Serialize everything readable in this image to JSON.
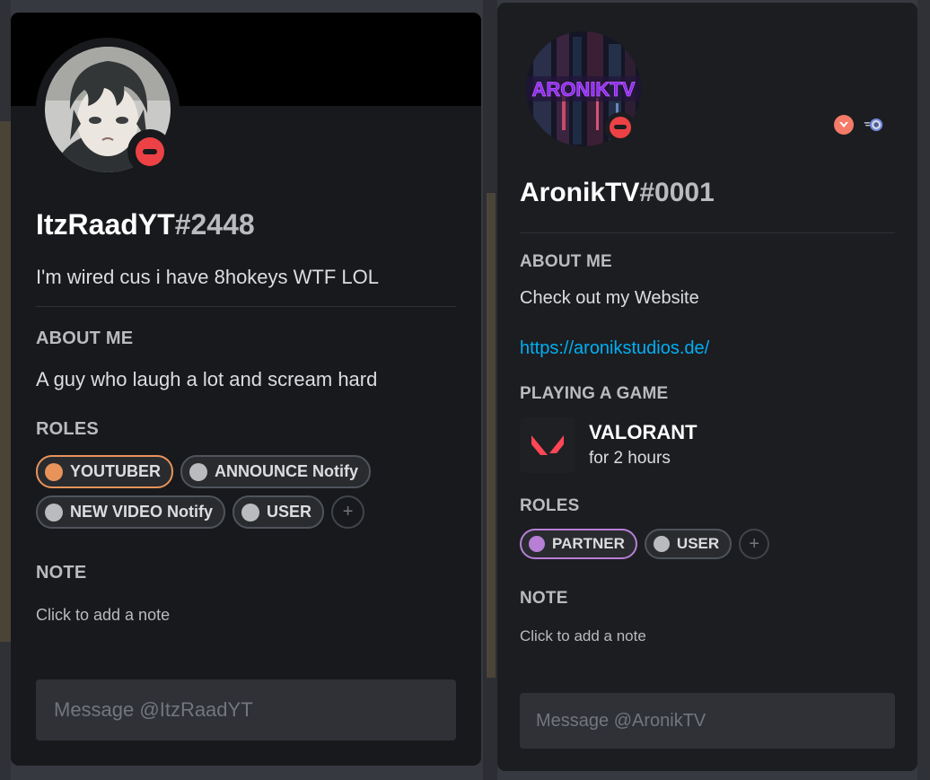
{
  "left_profile": {
    "username": "ItzRaadYT",
    "discriminator": "#2448",
    "custom_status": "I'm wired cus i have 8hokeys WTF LOL",
    "about_title": "ABOUT ME",
    "about_text": "A guy who laugh a lot and scream hard",
    "roles_title": "ROLES",
    "roles": [
      {
        "name": "YOUTUBER",
        "color": "#e8935a"
      },
      {
        "name": "ANNOUNCE Notify",
        "color": "#b9bbbe"
      },
      {
        "name": "NEW VIDEO Notify",
        "color": "#b9bbbe"
      },
      {
        "name": "USER",
        "color": "#b9bbbe"
      }
    ],
    "add_role": "+",
    "note_title": "NOTE",
    "note_placeholder": "Click to add a note",
    "message_placeholder": "Message @ItzRaadYT",
    "status": "do-not-disturb"
  },
  "right_profile": {
    "username": "AronikTV",
    "discriminator": "#0001",
    "avatar_text": "ARONIKTV",
    "about_title": "ABOUT ME",
    "about_text": "Check out my Website",
    "about_link": "https://aronikstudios.de/",
    "playing_title": "PLAYING A GAME",
    "game_name": "VALORANT",
    "game_time": "for 2 hours",
    "roles_title": "ROLES",
    "roles": [
      {
        "name": "PARTNER",
        "color": "#b87fd6"
      },
      {
        "name": "USER",
        "color": "#b9bbbe"
      }
    ],
    "add_role": "+",
    "note_title": "NOTE",
    "note_placeholder": "Click to add a note",
    "message_placeholder": "Message @AronikTV",
    "status": "do-not-disturb",
    "badges": [
      "hypesquad-icon",
      "early-supporter-icon"
    ]
  },
  "colors": {
    "card_bg": "#18191c",
    "dnd": "#ed4245",
    "link": "#00aff4",
    "youtuber_role": "#e8935a",
    "partner_role": "#b87fd6"
  }
}
